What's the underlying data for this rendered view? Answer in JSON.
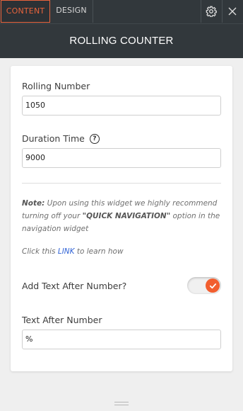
{
  "tabs": {
    "content": "CONTENT",
    "design": "DESIGN"
  },
  "icons": {
    "settings": "gear-icon",
    "close": "close-icon",
    "help": "help-icon",
    "toggle_check": "check-icon"
  },
  "header": {
    "title": "ROLLING COUNTER"
  },
  "form": {
    "rolling_number": {
      "label": "Rolling Number",
      "value": "1050"
    },
    "duration_time": {
      "label": "Duration Time",
      "help": "?",
      "value": "9000"
    },
    "note": {
      "prefix": "Note:",
      "text1": " Upon using this widget we highly recommend turning off your ",
      "highlight": "\"QUICK NAVIGATION\"",
      "text2": " option in the navigation widget"
    },
    "learn": {
      "before": "Click this ",
      "link": "LINK",
      "after": " to learn how"
    },
    "add_text_after": {
      "label": "Add Text After Number?",
      "enabled": true
    },
    "text_after": {
      "label": "Text After Number",
      "value": "%"
    }
  },
  "colors": {
    "accent": "#f25e2f",
    "header_bg": "#32383c",
    "link": "#2f62d6"
  }
}
